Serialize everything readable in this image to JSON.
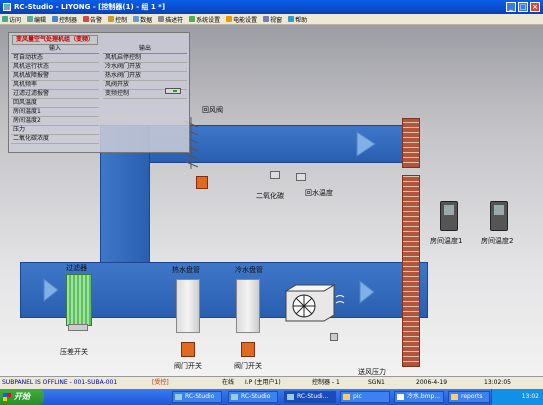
{
  "window": {
    "title": "RC-Studio - LIYONG - [控制器(1) - 组 1 *]"
  },
  "menu": {
    "items": [
      "访问",
      "编辑",
      "控制器",
      "告警",
      "控制",
      "数据",
      "描述符",
      "系统设置",
      "电能设置",
      "视窗",
      "帮助"
    ]
  },
  "panel": {
    "title": "变风量空气处理机组（变频）",
    "input_header": "输入",
    "output_header": "输出",
    "inputs": [
      "可自动状态",
      "风机运行状态",
      "风机故障报警",
      "风机频率",
      "过滤过滤报警",
      "回风温度",
      "房间温度1",
      "房间温度2",
      "压力",
      "二氧化碳浓度"
    ],
    "outputs": [
      "风机启停控制",
      "冷水阀门开放",
      "热水阀门开放",
      "风阀开放",
      "变频控制"
    ]
  },
  "diagram": {
    "return_damper": "回风阀",
    "co2": "二氧化碳",
    "return_temp": "回水温度",
    "filter": "过滤器",
    "diff_pressure_switch": "压差开关",
    "hot_coil": "热水盘管",
    "cold_coil": "冷水盘管",
    "valve_switch_1": "阀门开关",
    "valve_switch_2": "阀门开关",
    "supply_pressure": "送风压力",
    "room_temp_1": "房间温度1",
    "room_temp_2": "房间温度2"
  },
  "status": {
    "offline": "SUBPANEL IS OFFLINE - 001-SUBA-001",
    "state": "[受控]",
    "online": "在线",
    "user": "I.P (主用户1)",
    "controller": "控制器 - 1",
    "code": "SGN1",
    "date": "2006-4-19",
    "time": "13:02:05"
  },
  "taskbar": {
    "start": "开始",
    "tasks": [
      "RC-Studio",
      "RC-Studio",
      "RC-Studi...",
      "pic",
      "冷水.bmp...",
      "reports"
    ],
    "clock": "13:02"
  },
  "colors": {
    "duct": "#2f66b8",
    "brick": "#b2553c",
    "title": "#0a5ee8"
  }
}
